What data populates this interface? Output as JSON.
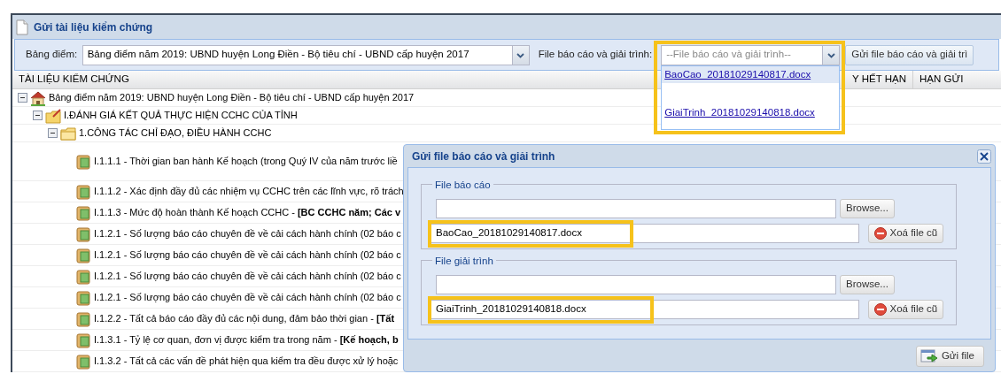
{
  "window": {
    "title": "Gửi tài liệu kiểm chứng"
  },
  "toolbar": {
    "scoreboard_label": "Bảng điểm:",
    "scoreboard_value": "Bảng điểm năm 2019: UBND huyện Long Điền - Bộ tiêu chí - UBND cấp huyện 2017",
    "file_label": "File báo cáo và giải trình:",
    "file_placeholder": "--File báo cáo và giải trình--",
    "send_button": "Gửi file báo cáo và giải trì"
  },
  "file_dropdown": {
    "expanded": true,
    "options": [
      {
        "label": "BaoCao_20181029140817.docx",
        "selected": true
      },
      {
        "label": "GiaiTrinh_20181029140818.docx",
        "selected": false
      }
    ]
  },
  "table": {
    "columns": [
      "TÀI LIỆU KIỂM CHỨNG",
      "Y HẾT HẠN",
      "HẠN GỬI"
    ]
  },
  "tree": [
    {
      "label": "Bảng điểm năm 2019: UBND huyện Long Điền - Bộ tiêu chí - UBND cấp huyện 2017",
      "kind": "root",
      "expanded": true,
      "children": [
        {
          "label": "I.ĐÁNH GIÁ KẾT QUẢ THỰC HIỆN CCHC CỦA TỈNH",
          "kind": "section",
          "expanded": true,
          "children": [
            {
              "label": "1.CÔNG TÁC CHỈ ĐẠO, ĐIỀU HÀNH CCHC",
              "kind": "folder",
              "expanded": true,
              "children": [
                {
                  "label": "I.1.1.1 - Thời gian ban hành Kế hoạch (trong Quý IV của năm trước liề",
                  "kind": "document"
                },
                {
                  "label": "I.1.1.2 - Xác định đầy đủ các nhiệm vụ CCHC trên các lĩnh vực, rõ trách",
                  "kind": "document"
                },
                {
                  "label": "I.1.1.3 - Mức độ hoàn thành Kế hoạch CCHC - **[BC CCHC năm; Các v**",
                  "kind": "document"
                },
                {
                  "label": "I.1.2.1 - Số lượng báo cáo chuyên đề về cải cách hành chính (02 báo c",
                  "kind": "document"
                },
                {
                  "label": "I.1.2.1 - Số lượng báo cáo chuyên đề về cải cách hành chính (02 báo c",
                  "kind": "document"
                },
                {
                  "label": "I.1.2.1 - Số lượng báo cáo chuyên đề về cải cách hành chính (02 báo c",
                  "kind": "document"
                },
                {
                  "label": "I.1.2.1 - Số lượng báo cáo chuyên đề về cải cách hành chính (02 báo c",
                  "kind": "document"
                },
                {
                  "label": "I.1.2.2 - Tất cả báo cáo đầy đủ các nội dung, đảm bảo thời gian - **[Tất**",
                  "kind": "document"
                },
                {
                  "label": "I.1.3.1 - Tỷ lệ cơ quan, đơn vị được kiểm tra trong năm - **[Kế hoạch, b**",
                  "kind": "document"
                },
                {
                  "label": "I.1.3.2 - Tất cả các vấn đề phát hiện qua kiểm tra đều được xử lý hoặc",
                  "kind": "document"
                }
              ]
            }
          ]
        }
      ]
    }
  ],
  "dialog": {
    "title": "Gửi file báo cáo và giải trình",
    "groups": [
      {
        "legend": "File báo cáo",
        "browse_button": "Browse...",
        "current_file": "BaoCao_20181029140817.docx",
        "delete_button": "Xoá file cũ"
      },
      {
        "legend": "File giải trình",
        "browse_button": "Browse...",
        "current_file": "GiaiTrinh_20181029140818.docx",
        "delete_button": "Xoá file cũ"
      }
    ],
    "submit_button": "Gửi file"
  }
}
